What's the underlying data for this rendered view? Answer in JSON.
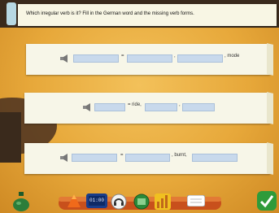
{
  "instruction": "Which irregular verb is it? Fill in the German word and the missing verb forms.",
  "questions": [
    {
      "equals": "=",
      "comma": ",",
      "hint": ", mode"
    },
    {
      "equals": "= ride,",
      "comma": ","
    },
    {
      "equals": "=",
      "comma": "",
      "hint": ", burnt,"
    }
  ],
  "toolbar": {
    "clock_text": "01:00"
  },
  "colors": {
    "accent_green": "#2f9b3a",
    "field_blue": "#c8d9ec"
  }
}
